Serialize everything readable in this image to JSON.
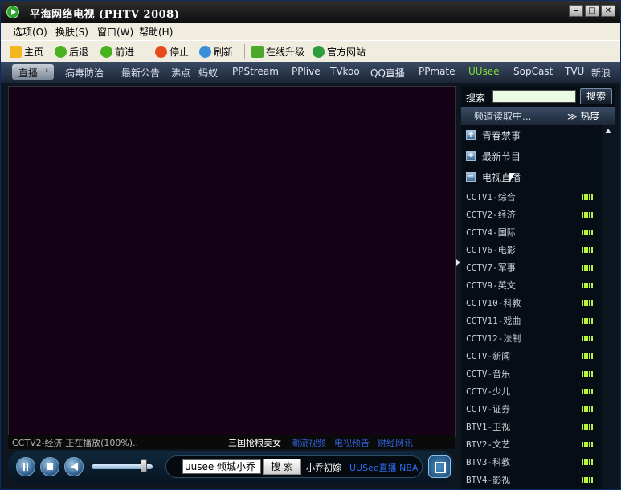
{
  "window": {
    "title": "平海网络电视 (PHTV 2008)",
    "buttons": [
      "‒",
      "□",
      "✕"
    ]
  },
  "menu": [
    "选项(O)",
    "换肤(S)",
    "窗口(W)",
    "帮助(H)"
  ],
  "toolbar": {
    "home": "主页",
    "back": "后退",
    "forward": "前进",
    "stop": "停止",
    "refresh": "刷新",
    "upgrade": "在线升级",
    "website": "官方网站"
  },
  "nav": {
    "active": "直播",
    "active_arrow": "›",
    "items": [
      "病毒防治",
      "最新公告",
      "沸点",
      "蚂蚁",
      "PPStream",
      "PPlive",
      "TVkoo",
      "QQ直播",
      "PPmate",
      "UUsee",
      "SopCast",
      "TVU",
      "新浪"
    ],
    "highlight_color": "#7ee03a"
  },
  "player": {
    "status": "CCTV2-经济 正在播放(100%)..",
    "ad_text": "三国抢粮美女",
    "ad_links": [
      "潮流视频",
      "电视预告",
      "财经网讯"
    ],
    "search_value": "uusee 倾城小乔",
    "search_button": "搜 索",
    "link1": "小乔初嫁",
    "link2": "UUSee直播 NBA",
    "volume_percent": 85
  },
  "sidebar": {
    "search_label": "搜索",
    "search_button": "搜索",
    "header_label": "频道读取中...",
    "sort_label": "≫ 热度",
    "groups": [
      {
        "label": "青春禁事",
        "symbol": "+"
      },
      {
        "label": "最新节目",
        "symbol": "+"
      },
      {
        "label": "电视直播",
        "symbol": "−"
      }
    ],
    "channels": [
      "CCTV1-综合",
      "CCTV2-经济",
      "CCTV4-国际",
      "CCTV6-电影",
      "CCTV7-军事",
      "CCTV9-英文",
      "CCTV10-科教",
      "CCTV11-戏曲",
      "CCTV12-法制",
      "CCTV-新闻",
      "CCTV-音乐",
      "CCTV-少儿",
      "CCTV-证券",
      "BTV1-卫视",
      "BTV2-文艺",
      "BTV3-科教",
      "BTV4-影视"
    ]
  }
}
